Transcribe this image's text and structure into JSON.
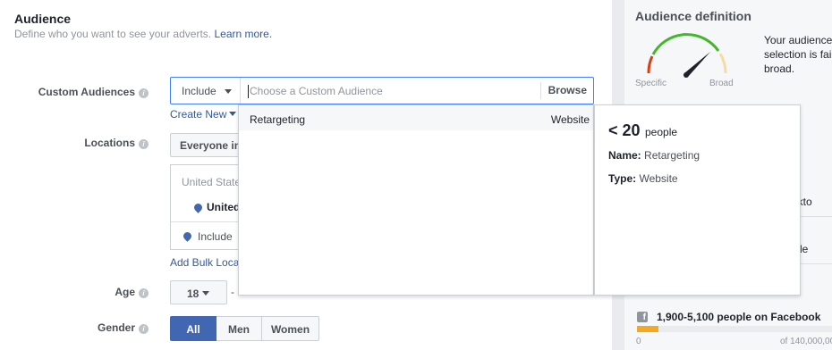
{
  "audience": {
    "title": "Audience",
    "subtitle": "Define who you want to see your adverts.",
    "learn_more": "Learn more."
  },
  "custom_audiences": {
    "label": "Custom Audiences",
    "include": "Include",
    "placeholder": "Choose a Custom Audience",
    "browse": "Browse",
    "create_new": "Create New"
  },
  "dropdown": {
    "items": [
      {
        "name": "Retargeting",
        "type": "Website"
      }
    ]
  },
  "tooltip": {
    "size": "< 20",
    "size_unit": "people",
    "name_label": "Name:",
    "name_value": "Retargeting",
    "type_label": "Type:",
    "type_value": "Website"
  },
  "locations": {
    "label": "Locations",
    "selector": "Everyone in",
    "country": "United States",
    "selected": "United",
    "include": "Include",
    "bulk": "Add Bulk Loca"
  },
  "age": {
    "label": "Age",
    "min": "18",
    "dash": "-"
  },
  "gender": {
    "label": "Gender",
    "options": [
      "All",
      "Men",
      "Women"
    ],
    "selected": "All"
  },
  "definition": {
    "title": "Audience definition",
    "specific": "Specific",
    "broad": "Broad",
    "desc_line1": "Your audience",
    "desc_line2": "selection is fai",
    "desc_line3": "broad.",
    "desktop": "eskto",
    "le": "le",
    "reach": "1,900-5,100 people on Facebook",
    "reach_fraction": 0.11,
    "bar_min": "0",
    "bar_max": "of 140,000,00",
    "colors": {
      "gauge_red": "#dd3c10",
      "gauge_green": "#42b72a",
      "gauge_yellow": "#f7dca0",
      "bar": "#f7a822"
    }
  }
}
